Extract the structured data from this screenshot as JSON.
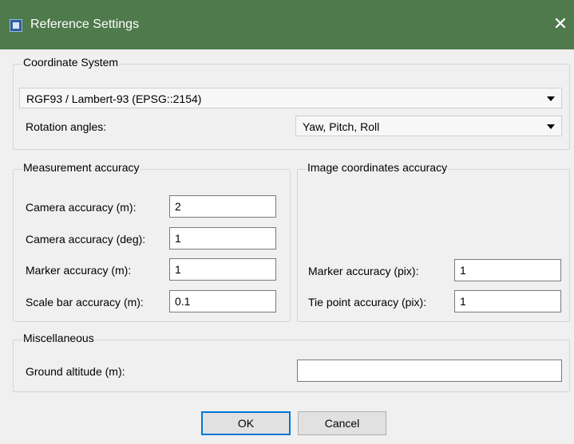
{
  "window": {
    "title": "Reference Settings",
    "close_glyph": "✕"
  },
  "coordinate_system": {
    "group_title": "Coordinate System",
    "crs_value": "RGF93 / Lambert-93 (EPSG::2154)",
    "rotation_label": "Rotation angles:",
    "rotation_value": "Yaw, Pitch, Roll"
  },
  "measurement_accuracy": {
    "group_title": "Measurement accuracy",
    "camera_m_label": "Camera accuracy (m):",
    "camera_m_value": "2",
    "camera_deg_label": "Camera accuracy (deg):",
    "camera_deg_value": "1",
    "marker_m_label": "Marker accuracy (m):",
    "marker_m_value": "1",
    "scalebar_m_label": "Scale bar accuracy (m):",
    "scalebar_m_value": "0.1"
  },
  "image_accuracy": {
    "group_title": "Image coordinates accuracy",
    "marker_pix_label": "Marker accuracy (pix):",
    "marker_pix_value": "1",
    "tiepoint_pix_label": "Tie point accuracy (pix):",
    "tiepoint_pix_value": "1"
  },
  "misc": {
    "group_title": "Miscellaneous",
    "ground_altitude_label": "Ground altitude (m):",
    "ground_altitude_value": ""
  },
  "buttons": {
    "ok": "OK",
    "cancel": "Cancel"
  },
  "icons": {
    "app": "app-icon",
    "close": "close-icon",
    "dropdown": "chevron-down-icon"
  }
}
